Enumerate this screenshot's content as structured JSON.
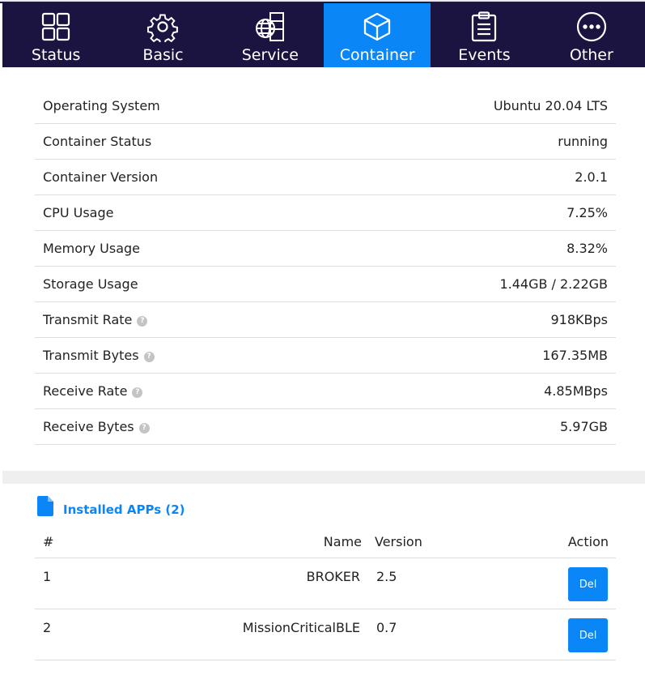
{
  "tabs": [
    {
      "label": "Status",
      "icon": "grid-icon"
    },
    {
      "label": "Basic",
      "icon": "gear-icon"
    },
    {
      "label": "Service",
      "icon": "globe-icon"
    },
    {
      "label": "Container",
      "icon": "box-icon",
      "active": true
    },
    {
      "label": "Events",
      "icon": "clipboard-icon"
    },
    {
      "label": "Other",
      "icon": "more-icon"
    }
  ],
  "info": [
    {
      "label": "Operating System",
      "value": "Ubuntu 20.04 LTS"
    },
    {
      "label": "Container Status",
      "value": "running"
    },
    {
      "label": "Container Version",
      "value": "2.0.1"
    },
    {
      "label": "CPU Usage",
      "value": "7.25%"
    },
    {
      "label": "Memory Usage",
      "value": "8.32%"
    },
    {
      "label": "Storage Usage",
      "value": "1.44GB / 2.22GB"
    },
    {
      "label": "Transmit Rate",
      "value": "918KBps",
      "help": "?"
    },
    {
      "label": "Transmit Bytes",
      "value": "167.35MB",
      "help": "?"
    },
    {
      "label": "Receive Rate",
      "value": "4.85MBps",
      "help": "?"
    },
    {
      "label": "Receive Bytes",
      "value": "5.97GB",
      "help": "?"
    }
  ],
  "apps": {
    "title": "Installed APPs (2)",
    "headers": {
      "num": "#",
      "name": "Name",
      "version": "Version",
      "action": "Action"
    },
    "rows": [
      {
        "num": "1",
        "name": "BROKER",
        "version": "2.5",
        "action": "Del"
      },
      {
        "num": "2",
        "name": "MissionCriticalBLE",
        "version": "0.7",
        "action": "Del"
      }
    ]
  },
  "colors": {
    "nav_bg": "#1b1440",
    "accent": "#0a86f6"
  }
}
